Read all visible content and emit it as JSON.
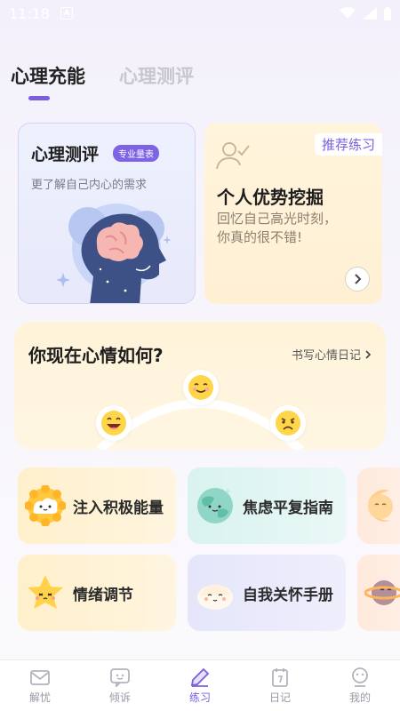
{
  "status_bar": {
    "time": "11:18",
    "notif": "A"
  },
  "tabs": [
    {
      "label": "心理充能",
      "active": true
    },
    {
      "label": "心理测评",
      "active": false
    }
  ],
  "test_card": {
    "title": "心理测评",
    "badge": "专业量表",
    "subtitle": "更了解自己内心的需求"
  },
  "recommend_card": {
    "badge": "推荐练习",
    "title": "个人优势挖掘",
    "desc_line1": "回忆自己高光时刻，",
    "desc_line2": "你真的很不错!"
  },
  "mood": {
    "title": "你现在心情如何?",
    "link": "书写心情日记"
  },
  "tiles": [
    {
      "label": "注入积极能量",
      "icon": "sun-face-icon"
    },
    {
      "label": "焦虑平复指南",
      "icon": "earth-face-icon"
    },
    {
      "label": "",
      "icon": "moon-icon"
    },
    {
      "label": "情绪调节",
      "icon": "star-face-icon"
    },
    {
      "label": "自我关怀手册",
      "icon": "dumpling-face-icon"
    },
    {
      "label": "",
      "icon": "planet-icon"
    }
  ],
  "tabbar": [
    {
      "label": "解忧",
      "icon": "mail-icon",
      "active": false
    },
    {
      "label": "倾诉",
      "icon": "chat-icon",
      "active": false
    },
    {
      "label": "练习",
      "icon": "pen-icon",
      "active": true
    },
    {
      "label": "日记",
      "icon": "calendar-icon",
      "active": false
    },
    {
      "label": "我的",
      "icon": "profile-icon",
      "active": false
    }
  ],
  "colors": {
    "accent": "#7b5ee0",
    "card_yellow": "#fff3d9",
    "card_blue": "#eef1fd"
  }
}
